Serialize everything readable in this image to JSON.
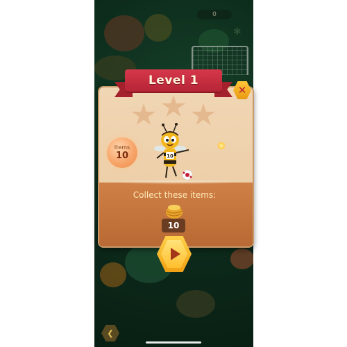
{
  "hud": {
    "score": "0"
  },
  "dialog": {
    "title": "Level 1",
    "close_icon": "close-icon",
    "stars": [
      {
        "name": "star-1",
        "filled": false
      },
      {
        "name": "star-2",
        "filled": false
      },
      {
        "name": "star-3",
        "filled": false
      }
    ],
    "items_badge": {
      "label": "Items",
      "value": "10"
    },
    "character": {
      "jersey": "10"
    },
    "collect_label": "Collect these items:",
    "target_item": {
      "icon": "honey-pot-icon",
      "count": "10"
    },
    "play_icon": "play-icon"
  },
  "nav": {
    "back_icon": "back-icon"
  },
  "colors": {
    "ribbon": "#c62d3f",
    "panel_top": "#efd3b0",
    "panel_bottom": "#c67540",
    "accent_gold": "#f5b52a",
    "background": "#123b26"
  }
}
